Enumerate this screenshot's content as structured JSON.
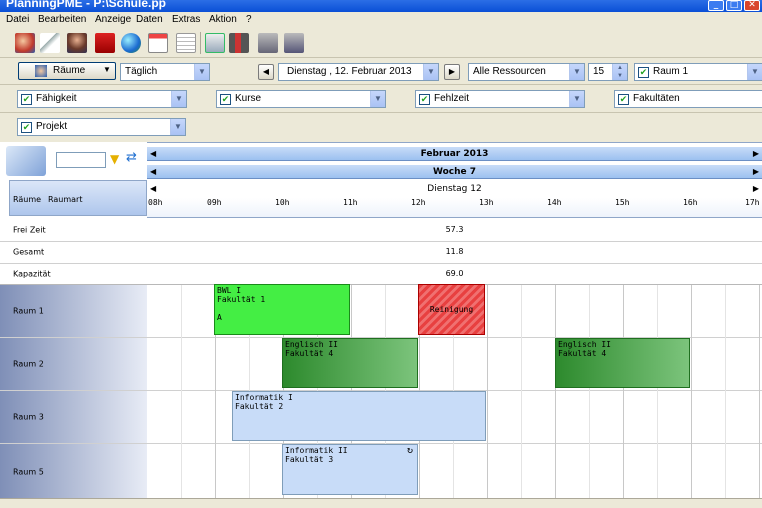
{
  "window": {
    "title": "PlanningPME - P:\\Schule.pp"
  },
  "menu": [
    "Datei",
    "Bearbeiten",
    "Anzeige",
    "Daten",
    "Extras",
    "Aktion",
    "?"
  ],
  "toolbar_icons": [
    "users-icon",
    "pen-icon",
    "team-icon",
    "book-icon",
    "globe-icon",
    "calendar-icon",
    "table-icon",
    "add-task-icon",
    "report-icon",
    "print-icon",
    "print-preview-icon"
  ],
  "filters": {
    "resource_type": "Räume",
    "view_mode": "Täglich",
    "date": "Dienstag  , 12.   Februar   2013",
    "resources": "Alle Ressourcen",
    "count": "15",
    "room": "Raum 1",
    "skill": "Fähigkeit",
    "course": "Kurse",
    "absence": "Fehlzeit",
    "faculty": "Fakultäten",
    "project": "Projekt"
  },
  "header": {
    "month": "Februar 2013",
    "week": "Woche 7",
    "day": "Dienstag 12"
  },
  "columns": {
    "rooms": "Räume",
    "room_type": "Raumart"
  },
  "hours": [
    "08h",
    "09h",
    "10h",
    "11h",
    "12h",
    "13h",
    "14h",
    "15h",
    "16h",
    "17h"
  ],
  "stats": [
    {
      "label": "Frei Zeit",
      "value": "57.3"
    },
    {
      "label": "Gesamt",
      "value": "11.8"
    },
    {
      "label": "Kapazität",
      "value": "69.0"
    }
  ],
  "rooms": [
    "Raum 1",
    "Raum 2",
    "Raum 3",
    "Raum 5"
  ],
  "events": [
    {
      "room": 0,
      "line1": "BWL I",
      "line2": "Fakultät 1",
      "line3": "A",
      "color": "#44ee44"
    },
    {
      "room": 0,
      "line1": "Reinigung",
      "line2": "",
      "line3": "",
      "color": "#e84040"
    },
    {
      "room": 1,
      "line1": "Englisch II",
      "line2": "Fakultät 4",
      "line3": "",
      "color": "#3aa33a"
    },
    {
      "room": 1,
      "line1": "Englisch II",
      "line2": "Fakultät 4",
      "line3": "",
      "color": "#3aa33a"
    },
    {
      "room": 2,
      "line1": "Informatik I",
      "line2": "Fakultät 2",
      "line3": "",
      "color": "#c8dcf8"
    },
    {
      "room": 3,
      "line1": "Informatik II",
      "line2": "Fakultät 3",
      "line3": "",
      "color": "#c8dcf8"
    }
  ]
}
